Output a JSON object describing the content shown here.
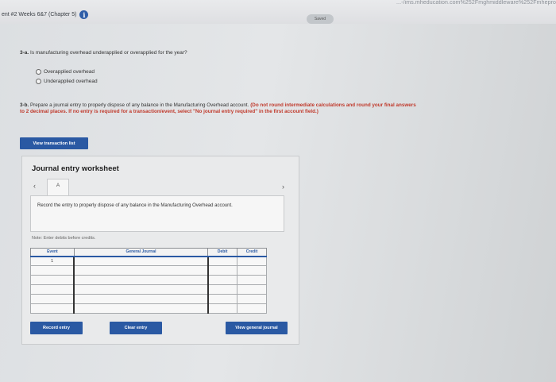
{
  "browser": {
    "url_fragment": "...-/ims.mheducation.com%252Fmghmiddleware%252Fmhepro"
  },
  "header": {
    "assignment_title": "ent #2 Weeks 6&7 (Chapter 5)",
    "saved_label": "Saved"
  },
  "question_3a": {
    "label": "3-a.",
    "text": "Is manufacturing overhead underapplied or overapplied for the year?",
    "options": [
      "Overapplied overhead",
      "Underapplied overhead"
    ]
  },
  "question_3b": {
    "label": "3-b.",
    "text": "Prepare a journal entry to properly dispose of any balance in the Manufacturing Overhead account.",
    "instruction": "(Do not round intermediate calculations and round your final answers to 2 decimal places. If no entry is required for a transaction/event, select \"No journal entry required\" in the first account field.)"
  },
  "view_transaction_list_label": "View transaction list",
  "worksheet": {
    "title": "Journal entry worksheet",
    "tab_label": "A",
    "instruction": "Record the entry to properly dispose of any balance in the Manufacturing Overhead account.",
    "note": "Note: Enter debits before credits.",
    "columns": [
      "Event",
      "General Journal",
      "Debit",
      "Credit"
    ],
    "rows": [
      {
        "event": "1",
        "account": "",
        "debit": "",
        "credit": ""
      },
      {
        "event": "",
        "account": "",
        "debit": "",
        "credit": ""
      },
      {
        "event": "",
        "account": "",
        "debit": "",
        "credit": ""
      },
      {
        "event": "",
        "account": "",
        "debit": "",
        "credit": ""
      },
      {
        "event": "",
        "account": "",
        "debit": "",
        "credit": ""
      },
      {
        "event": "",
        "account": "",
        "debit": "",
        "credit": ""
      }
    ],
    "record_entry_label": "Record entry",
    "clear_entry_label": "Clear entry",
    "view_general_journal_label": "View general journal"
  },
  "colors": {
    "button_blue": "#2a59a3",
    "instruction_red": "#c0392b"
  }
}
